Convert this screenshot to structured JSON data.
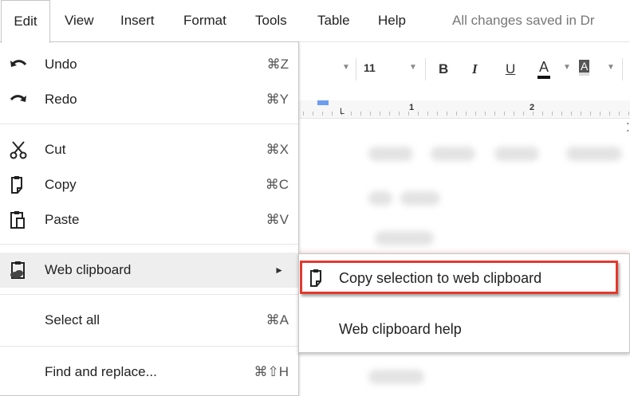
{
  "menubar": {
    "items": [
      "Edit",
      "View",
      "Insert",
      "Format",
      "Tools",
      "Table",
      "Help"
    ],
    "status": "All changes saved in Dr"
  },
  "toolbar": {
    "font_size": "11",
    "bold": "B",
    "italic": "I",
    "underline": "U",
    "text_color": "A",
    "highlight": "A"
  },
  "ruler": {
    "marks": [
      "1",
      "2"
    ]
  },
  "edit_menu": {
    "undo": {
      "label": "Undo",
      "shortcut": "⌘Z",
      "icon": "undo-icon"
    },
    "redo": {
      "label": "Redo",
      "shortcut": "⌘Y",
      "icon": "redo-icon"
    },
    "cut": {
      "label": "Cut",
      "shortcut": "⌘X",
      "icon": "scissors-icon"
    },
    "copy": {
      "label": "Copy",
      "shortcut": "⌘C",
      "icon": "copy-icon"
    },
    "paste": {
      "label": "Paste",
      "shortcut": "⌘V",
      "icon": "paste-icon"
    },
    "web_clipboard": {
      "label": "Web clipboard",
      "icon": "web-clipboard-icon"
    },
    "select_all": {
      "label": "Select all",
      "shortcut": "⌘A"
    },
    "find_replace": {
      "label": "Find and replace...",
      "shortcut": "⌘⇧H"
    }
  },
  "submenu": {
    "copy_selection": "Copy selection to web clipboard",
    "help": "Web clipboard help"
  },
  "colors": {
    "highlight_border": "#e23a2e",
    "hover_bg": "#eeeeee"
  }
}
